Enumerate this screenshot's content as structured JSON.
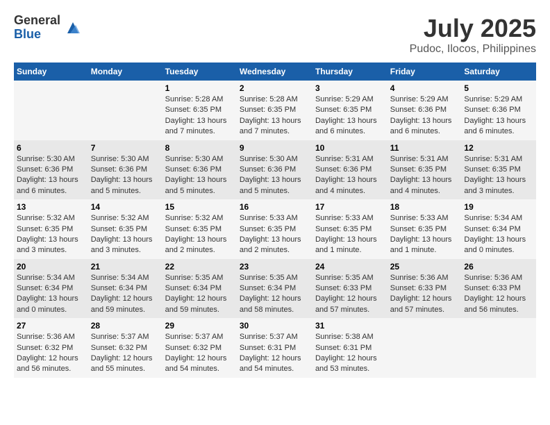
{
  "header": {
    "logo_general": "General",
    "logo_blue": "Blue",
    "month_year": "July 2025",
    "location": "Pudoc, Ilocos, Philippines"
  },
  "weekdays": [
    "Sunday",
    "Monday",
    "Tuesday",
    "Wednesday",
    "Thursday",
    "Friday",
    "Saturday"
  ],
  "rows": [
    [
      {
        "day": "",
        "info": ""
      },
      {
        "day": "",
        "info": ""
      },
      {
        "day": "1",
        "info": "Sunrise: 5:28 AM\nSunset: 6:35 PM\nDaylight: 13 hours and 7 minutes."
      },
      {
        "day": "2",
        "info": "Sunrise: 5:28 AM\nSunset: 6:35 PM\nDaylight: 13 hours and 7 minutes."
      },
      {
        "day": "3",
        "info": "Sunrise: 5:29 AM\nSunset: 6:35 PM\nDaylight: 13 hours and 6 minutes."
      },
      {
        "day": "4",
        "info": "Sunrise: 5:29 AM\nSunset: 6:36 PM\nDaylight: 13 hours and 6 minutes."
      },
      {
        "day": "5",
        "info": "Sunrise: 5:29 AM\nSunset: 6:36 PM\nDaylight: 13 hours and 6 minutes."
      }
    ],
    [
      {
        "day": "6",
        "info": "Sunrise: 5:30 AM\nSunset: 6:36 PM\nDaylight: 13 hours and 6 minutes."
      },
      {
        "day": "7",
        "info": "Sunrise: 5:30 AM\nSunset: 6:36 PM\nDaylight: 13 hours and 5 minutes."
      },
      {
        "day": "8",
        "info": "Sunrise: 5:30 AM\nSunset: 6:36 PM\nDaylight: 13 hours and 5 minutes."
      },
      {
        "day": "9",
        "info": "Sunrise: 5:30 AM\nSunset: 6:36 PM\nDaylight: 13 hours and 5 minutes."
      },
      {
        "day": "10",
        "info": "Sunrise: 5:31 AM\nSunset: 6:36 PM\nDaylight: 13 hours and 4 minutes."
      },
      {
        "day": "11",
        "info": "Sunrise: 5:31 AM\nSunset: 6:35 PM\nDaylight: 13 hours and 4 minutes."
      },
      {
        "day": "12",
        "info": "Sunrise: 5:31 AM\nSunset: 6:35 PM\nDaylight: 13 hours and 3 minutes."
      }
    ],
    [
      {
        "day": "13",
        "info": "Sunrise: 5:32 AM\nSunset: 6:35 PM\nDaylight: 13 hours and 3 minutes."
      },
      {
        "day": "14",
        "info": "Sunrise: 5:32 AM\nSunset: 6:35 PM\nDaylight: 13 hours and 3 minutes."
      },
      {
        "day": "15",
        "info": "Sunrise: 5:32 AM\nSunset: 6:35 PM\nDaylight: 13 hours and 2 minutes."
      },
      {
        "day": "16",
        "info": "Sunrise: 5:33 AM\nSunset: 6:35 PM\nDaylight: 13 hours and 2 minutes."
      },
      {
        "day": "17",
        "info": "Sunrise: 5:33 AM\nSunset: 6:35 PM\nDaylight: 13 hours and 1 minute."
      },
      {
        "day": "18",
        "info": "Sunrise: 5:33 AM\nSunset: 6:35 PM\nDaylight: 13 hours and 1 minute."
      },
      {
        "day": "19",
        "info": "Sunrise: 5:34 AM\nSunset: 6:34 PM\nDaylight: 13 hours and 0 minutes."
      }
    ],
    [
      {
        "day": "20",
        "info": "Sunrise: 5:34 AM\nSunset: 6:34 PM\nDaylight: 13 hours and 0 minutes."
      },
      {
        "day": "21",
        "info": "Sunrise: 5:34 AM\nSunset: 6:34 PM\nDaylight: 12 hours and 59 minutes."
      },
      {
        "day": "22",
        "info": "Sunrise: 5:35 AM\nSunset: 6:34 PM\nDaylight: 12 hours and 59 minutes."
      },
      {
        "day": "23",
        "info": "Sunrise: 5:35 AM\nSunset: 6:34 PM\nDaylight: 12 hours and 58 minutes."
      },
      {
        "day": "24",
        "info": "Sunrise: 5:35 AM\nSunset: 6:33 PM\nDaylight: 12 hours and 57 minutes."
      },
      {
        "day": "25",
        "info": "Sunrise: 5:36 AM\nSunset: 6:33 PM\nDaylight: 12 hours and 57 minutes."
      },
      {
        "day": "26",
        "info": "Sunrise: 5:36 AM\nSunset: 6:33 PM\nDaylight: 12 hours and 56 minutes."
      }
    ],
    [
      {
        "day": "27",
        "info": "Sunrise: 5:36 AM\nSunset: 6:32 PM\nDaylight: 12 hours and 56 minutes."
      },
      {
        "day": "28",
        "info": "Sunrise: 5:37 AM\nSunset: 6:32 PM\nDaylight: 12 hours and 55 minutes."
      },
      {
        "day": "29",
        "info": "Sunrise: 5:37 AM\nSunset: 6:32 PM\nDaylight: 12 hours and 54 minutes."
      },
      {
        "day": "30",
        "info": "Sunrise: 5:37 AM\nSunset: 6:31 PM\nDaylight: 12 hours and 54 minutes."
      },
      {
        "day": "31",
        "info": "Sunrise: 5:38 AM\nSunset: 6:31 PM\nDaylight: 12 hours and 53 minutes."
      },
      {
        "day": "",
        "info": ""
      },
      {
        "day": "",
        "info": ""
      }
    ]
  ]
}
